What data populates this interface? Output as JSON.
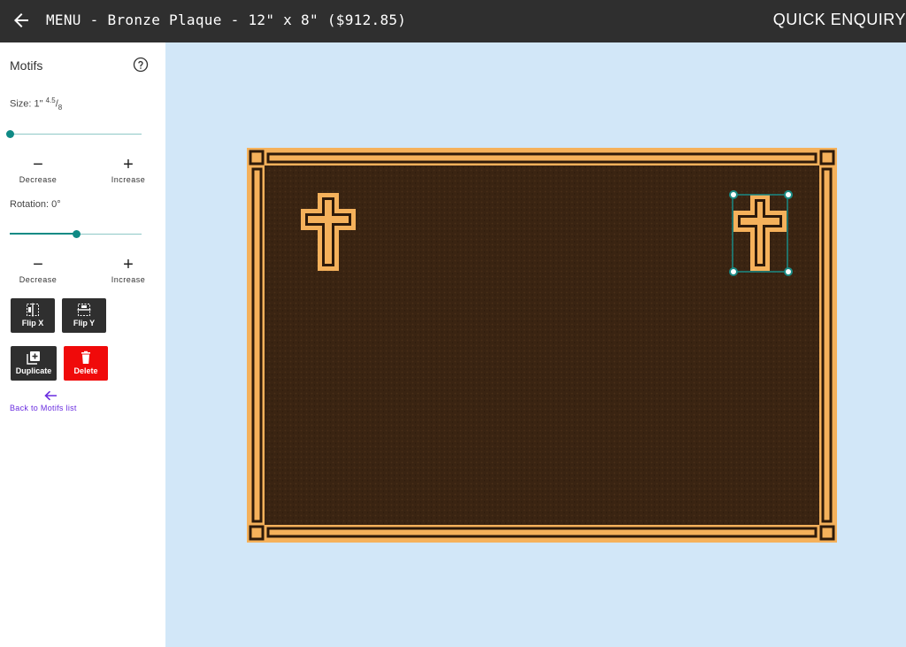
{
  "header": {
    "title": "MENU - Bronze Plaque - 12\" x 8\" ($912.85)",
    "quick_enquiry": "QUICK ENQUIRY"
  },
  "sidebar": {
    "title": "Motifs",
    "size": {
      "label": "Size: 1\"",
      "frac_num": "4.5",
      "frac_den": "8",
      "value": 0.0
    },
    "rotation": {
      "label": "Rotation: 0°",
      "value": 0.5
    },
    "decrease_label": "Decrease",
    "increase_label": "Increase",
    "minus_symbol": "−",
    "plus_symbol": "+",
    "flip_x": "Flip X",
    "flip_y": "Flip Y",
    "duplicate": "Duplicate",
    "delete": "Delete",
    "back_to_list": "Back to Motifs list"
  },
  "colors": {
    "topbar": "#2f2f2f",
    "canvas_bg": "#d2e7f8",
    "accent": "#0f8a85",
    "delete": "#f00a0a",
    "plaque_border": "#f5b15b",
    "plaque_face": "#3a2412",
    "link": "#6a2de0"
  },
  "icons": {
    "back": "arrow-left-icon",
    "help": "help-circle-icon",
    "flip_x": "flip-horizontal-icon",
    "flip_y": "flip-vertical-icon",
    "duplicate": "duplicate-icon",
    "delete": "trash-icon",
    "motif": "cross-icon"
  }
}
